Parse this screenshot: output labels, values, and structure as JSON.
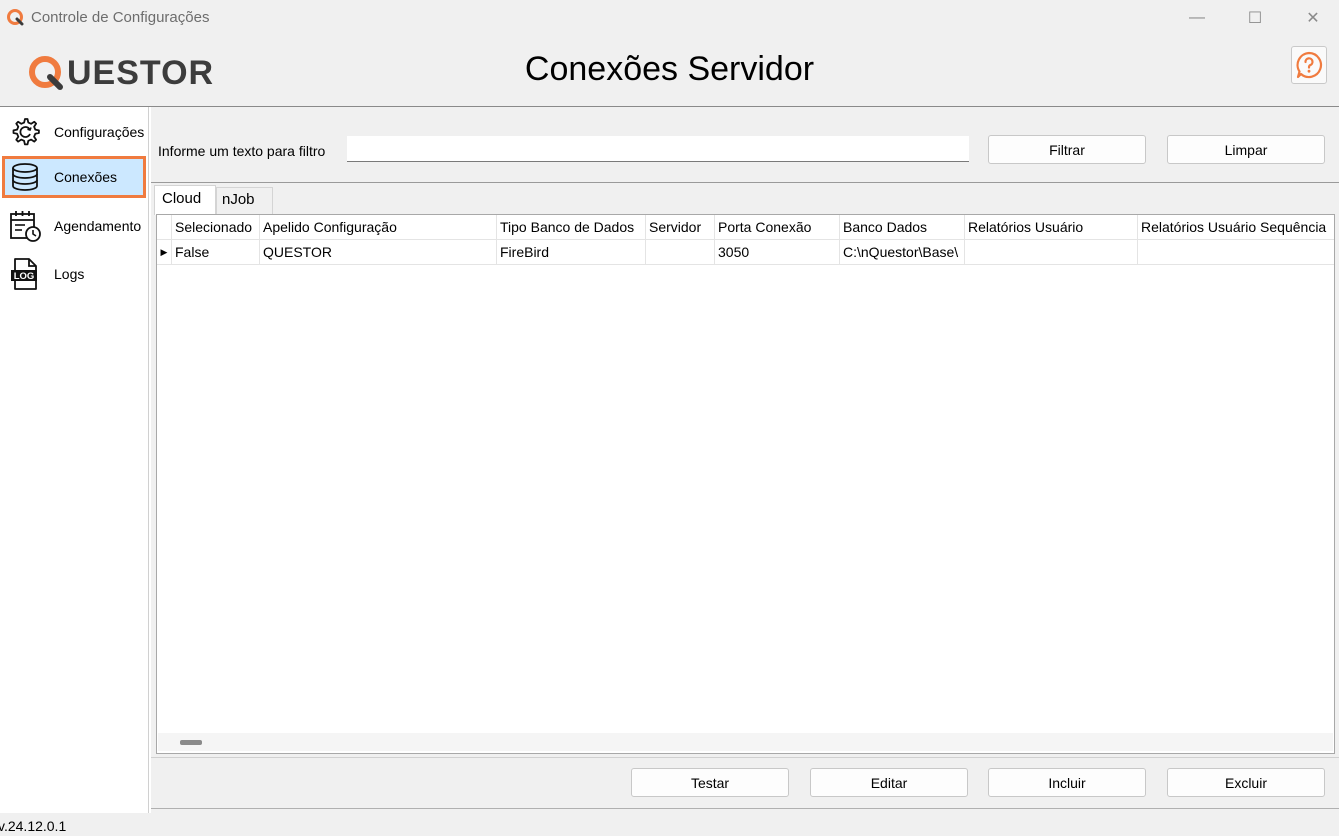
{
  "window": {
    "title": "Controle de Configurações",
    "min_symbol": "—",
    "max_symbol": "☐",
    "close_symbol": "✕"
  },
  "header": {
    "logo_text": "UESTOR",
    "page_title": "Conexões Servidor",
    "help_icon": "question-bubble-icon",
    "accent_color": "#f07b3f"
  },
  "sidebar": {
    "items": [
      {
        "label": "Configurações",
        "icon": "gear-icon"
      },
      {
        "label": "Conexões",
        "icon": "database-icon",
        "active": true
      },
      {
        "label": "Agendamento",
        "icon": "calendar-clock-icon"
      },
      {
        "label": "Logs",
        "icon": "log-file-icon",
        "badge": "LOG"
      }
    ]
  },
  "filter": {
    "label": "Informe um texto para filtro",
    "value": "",
    "filter_button": "Filtrar",
    "clear_button": "Limpar"
  },
  "tabs": [
    {
      "label": "Cloud",
      "active": true
    },
    {
      "label": "nJob",
      "active": false
    }
  ],
  "grid": {
    "columns": [
      "Selecionado",
      "Apelido Configuração",
      "Tipo Banco de Dados",
      "Servidor",
      "Porta Conexão",
      "Banco Dados",
      "Relatórios Usuário",
      "Relatórios Usuário Sequência"
    ],
    "rows": [
      [
        "False",
        "QUESTOR",
        "FireBird",
        "",
        "3050",
        "C:\\nQuestor\\Base\\",
        "",
        ""
      ]
    ],
    "current_row_marker": "▶"
  },
  "actions": {
    "test": "Testar",
    "edit": "Editar",
    "add": "Incluir",
    "delete": "Excluir"
  },
  "status": {
    "version": "v.24.12.0.1"
  }
}
